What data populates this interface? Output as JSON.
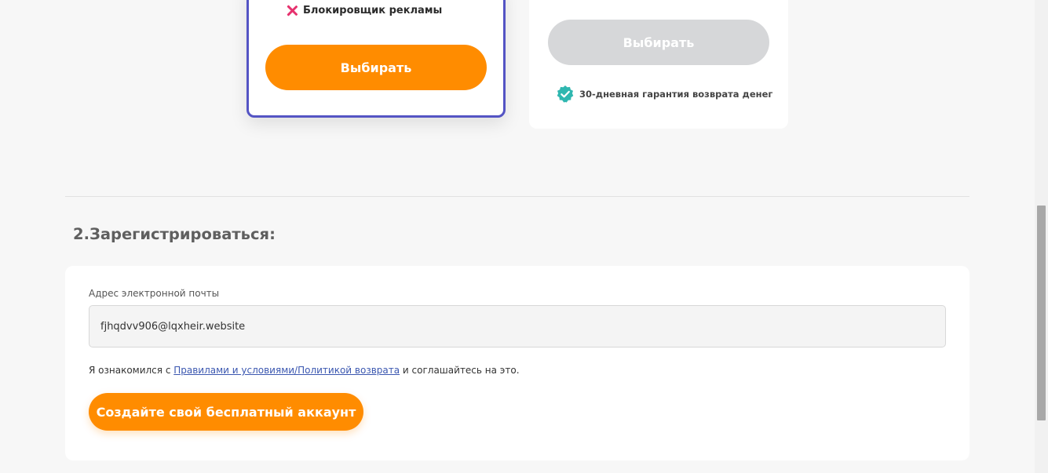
{
  "plans": {
    "pro": {
      "feature_label": "Блокировщик рекламы",
      "feature_icon": "close-icon",
      "select_label": "Выбирать"
    },
    "basic": {
      "select_label": "Выбирать",
      "guarantee_label": "30-дневная гарантия возврата денег",
      "guarantee_icon": "check-badge-icon"
    }
  },
  "signup": {
    "section_title": "2.Зарегистрироваться:",
    "email_label": "Адрес электронной почты",
    "email_value": "fjhqdvv906@lqxheir.website",
    "terms_prefix": "Я ознакомился с ",
    "terms_link": "Правилами и условиями/Политикой возврата",
    "terms_suffix": " и соглашайтесь на это.",
    "create_button": "Создайте свой бесплатный аккаунт"
  },
  "colors": {
    "accent": "#ff8c00",
    "pro_border": "#5454c4",
    "disabled_button": "#d6d7d9",
    "cross": "#e6326e",
    "badge": "#2fb7b0",
    "link": "#3b57b0"
  }
}
